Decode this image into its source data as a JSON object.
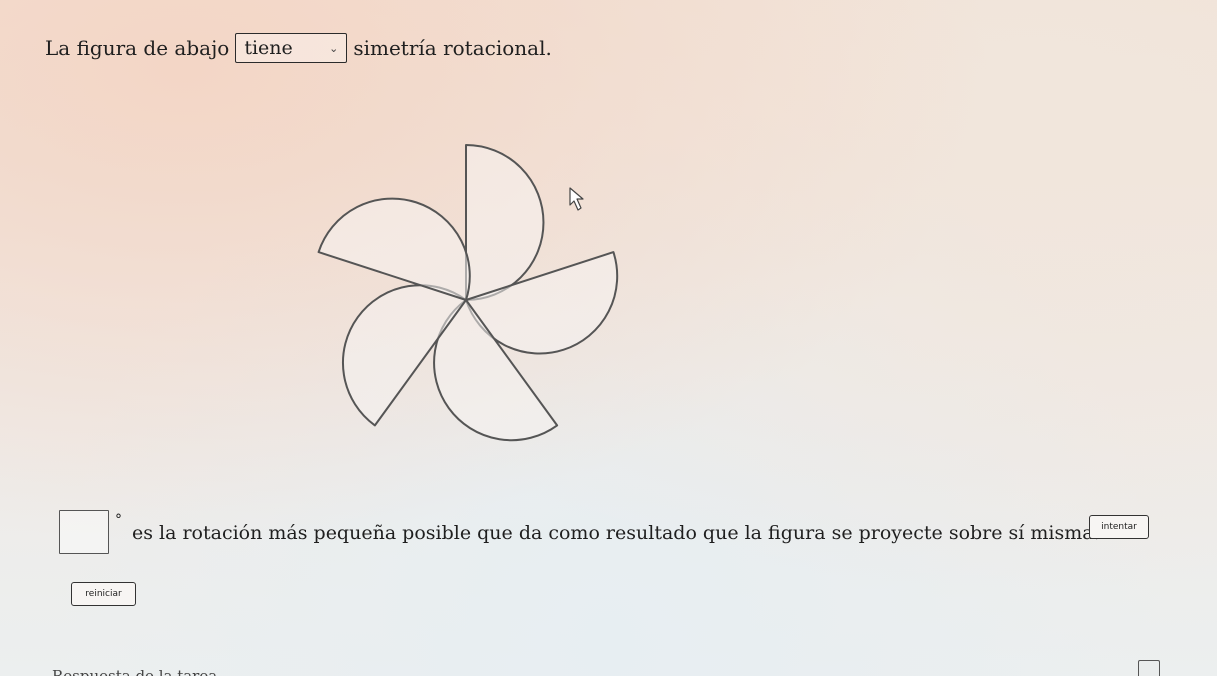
{
  "question": {
    "prefix": "La figura de abajo",
    "select_value": "tiene",
    "suffix": "simetría rotacional."
  },
  "answer": {
    "input_value": "",
    "degree_symbol": "°",
    "text": "es la rotación más pequeña posible que da como resultado que la figura se proyecte sobre sí misma."
  },
  "buttons": {
    "try_label": "intentar",
    "reset_label": "reiniciar"
  },
  "icons": {
    "select": "chevron-down-icon",
    "cursor": "mouse-pointer-icon",
    "corner": "window-tab-icon"
  },
  "figure": {
    "shape": "pinwheel of five half-disc petals",
    "petal_count": 5,
    "stroke_color": "#555555",
    "fill_color": "#f5f3f1"
  },
  "bottom_text": "Respuesta de la tarea"
}
